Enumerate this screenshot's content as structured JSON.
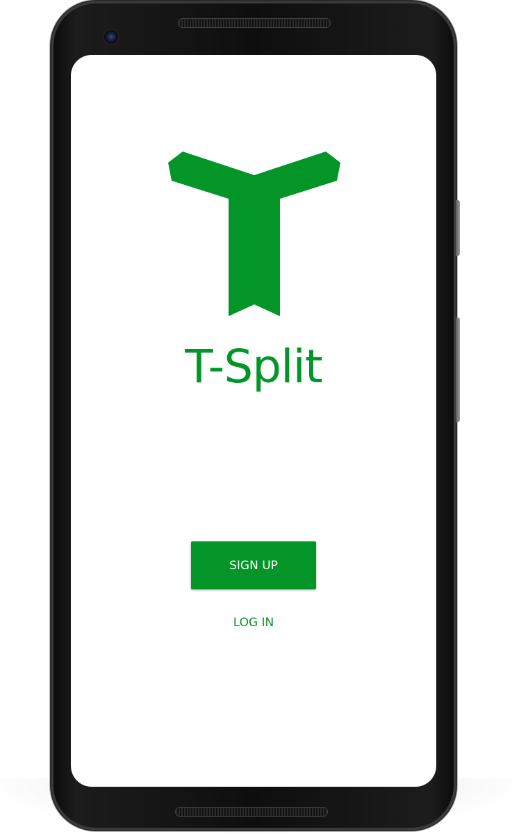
{
  "app": {
    "name": "T-Split",
    "logo_icon": "t-split-logo-icon",
    "brand_color": "#039528"
  },
  "actions": {
    "signup_label": "SIGN UP",
    "login_label": "LOG IN"
  },
  "device": {
    "frame_color": "#0e0e0e",
    "screen_color": "#ffffff"
  }
}
